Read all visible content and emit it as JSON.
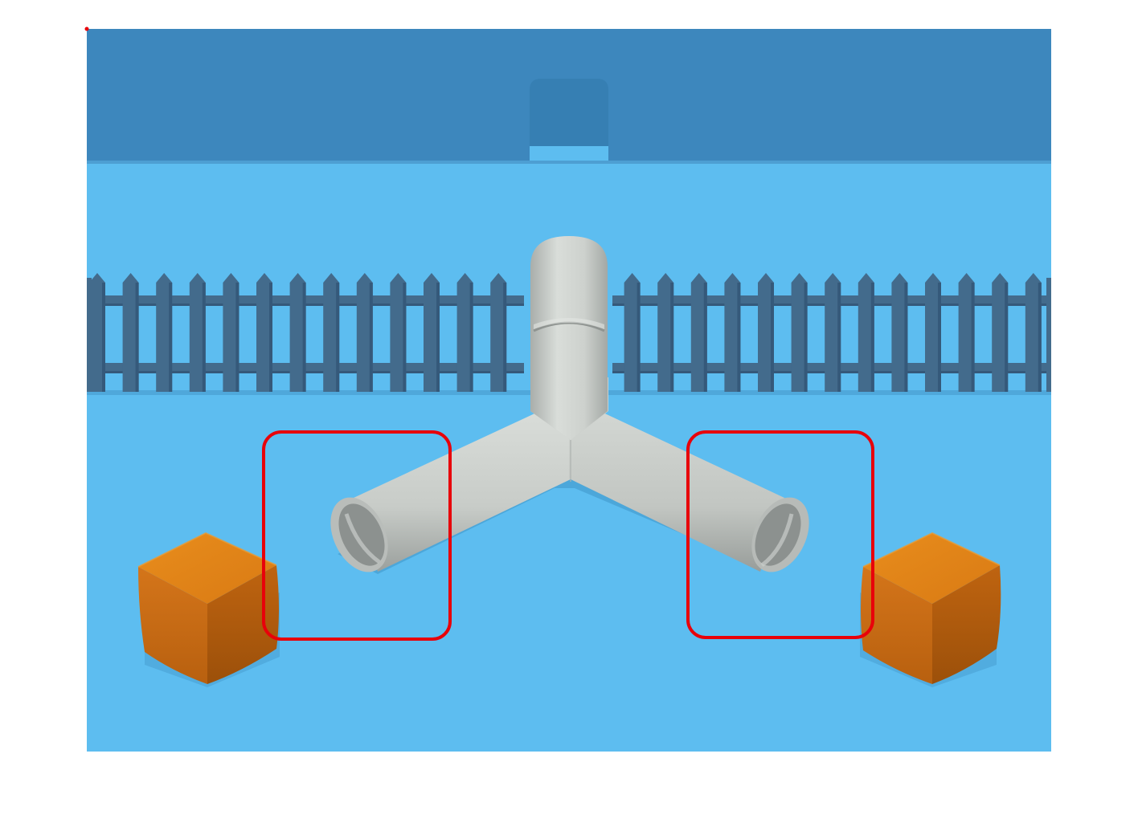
{
  "scene": {
    "kind": "3d puzzle scene",
    "colors": {
      "page_background": "#ffffff",
      "back_wall": "#3d87bd",
      "back_wall_notch": "#357fb2",
      "floor": "#5dbdf0",
      "floor_shadow": "#4aa6d8",
      "fence": "#436b8c",
      "fence_shadow": "#35597a",
      "pipe_light": "#d6dad6",
      "pipe_mid": "#c4c8c4",
      "pipe_dark": "#9ea3a0",
      "pipe_inner": "#8c918f",
      "crate_top": "#e08419",
      "crate_left": "#cc6e12",
      "crate_right": "#b55c0c",
      "highlight": "#e8000a"
    },
    "objects": {
      "pipe": "y-pipe",
      "pipe_openings": [
        "left-opening",
        "right-opening"
      ],
      "crates": [
        "left-crate",
        "right-crate"
      ],
      "highlights": [
        "left-pipe-end-highlight",
        "right-pipe-end-highlight"
      ]
    }
  }
}
